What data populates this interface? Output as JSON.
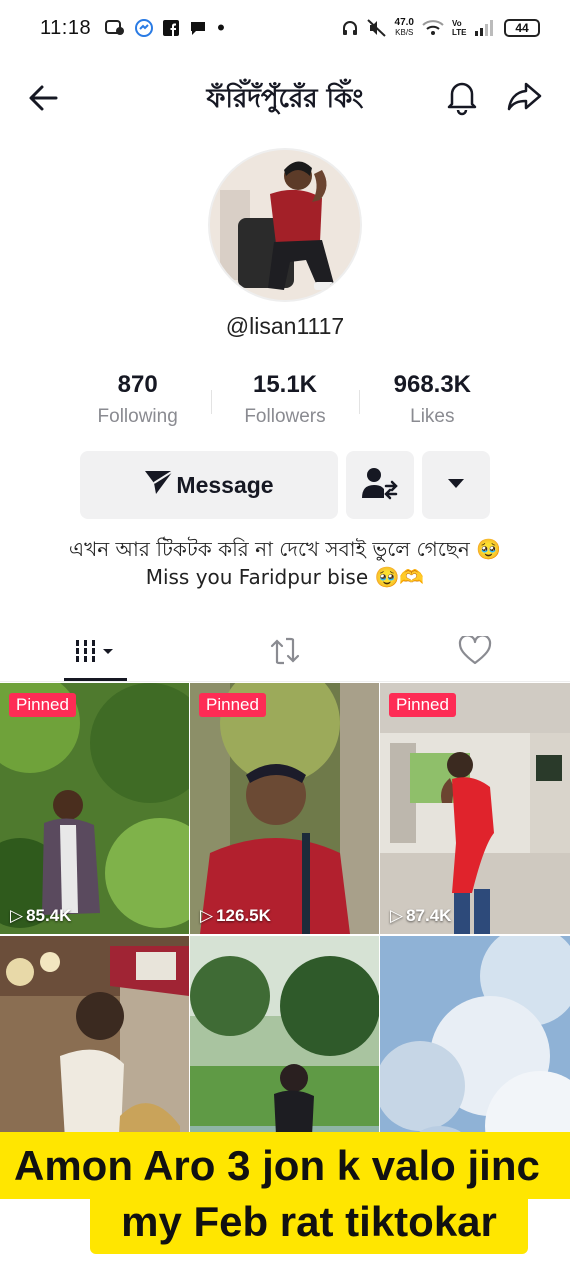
{
  "status_bar": {
    "time": "11:18",
    "net_speed_value": "47.0",
    "net_speed_unit": "KB/S",
    "volte": "Vo LTE",
    "battery": "44"
  },
  "header": {
    "title": "ফঁরিঁদঁপুঁরেঁর কিঁং"
  },
  "profile": {
    "username": "@lisan1117",
    "stats": [
      {
        "value": "870",
        "label": "Following"
      },
      {
        "value": "15.1K",
        "label": "Followers"
      },
      {
        "value": "968.3K",
        "label": "Likes"
      }
    ],
    "message_label": "Message",
    "bio_line1": "এখন আর টিকটক করি না দেখে সবাই ভুলে গেছেন 🥹",
    "bio_line2": "Miss you Faridpur bise 🥹🫶"
  },
  "videos": [
    {
      "pinned": "Pinned",
      "views": "85.4K"
    },
    {
      "pinned": "Pinned",
      "views": "126.5K"
    },
    {
      "pinned": "Pinned",
      "views": "87.4K"
    },
    {
      "pinned": "",
      "views": ""
    },
    {
      "pinned": "",
      "views": ""
    },
    {
      "pinned": "",
      "views": ""
    }
  ],
  "caption": {
    "line1": "Amon Aro 3 jon k valo jinc",
    "line2": "my Feb rat tiktokar"
  },
  "colors": {
    "accent": "#fe2c55",
    "caption_bg": "#ffe600",
    "button_bg": "#f1f1f2"
  }
}
